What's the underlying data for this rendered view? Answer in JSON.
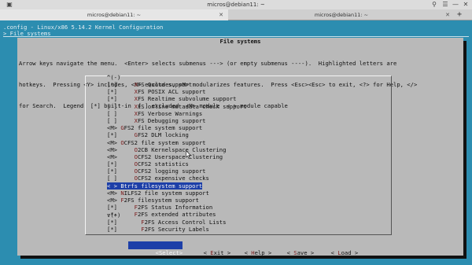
{
  "window": {
    "title": "micros@debian11: ~",
    "tabs": [
      {
        "label": "micros@debian11: ~",
        "active": true
      },
      {
        "label": "micros@debian11: ~",
        "active": false
      }
    ]
  },
  "terminal": {
    "config_line": ".config - Linux/x86 5.14.2 Kernel Configuration",
    "breadcrumb": "> File systems"
  },
  "dialog": {
    "title": "File systems",
    "help_lines": [
      "Arrow keys navigate the menu.  <Enter> selects submenus ---> (or empty submenus ----).  Highlighted letters are",
      "hotkeys.  Pressing <Y> includes, <N> excludes, <M> modularizes features.  Press <Esc><Esc> to exit, <?> for Help, </>",
      "for Search.  Legend: [*] built-in  [ ] excluded  <M> module  < > module capable"
    ],
    "scroll_up": "^(-)",
    "scroll_down": "v(+)",
    "items": [
      {
        "prefix": "[*]     ",
        "hotkey": "X",
        "rest": "FS Quota support",
        "selected": false
      },
      {
        "prefix": "[*]     ",
        "hotkey": "X",
        "rest": "FS POSIX ACL support",
        "selected": false
      },
      {
        "prefix": "[*]     ",
        "hotkey": "X",
        "rest": "FS Realtime subvolume support",
        "selected": false
      },
      {
        "prefix": "[ ]     ",
        "hotkey": "X",
        "rest": "FS online metadata check support",
        "selected": false
      },
      {
        "prefix": "[ ]     ",
        "hotkey": "X",
        "rest": "FS Verbose Warnings",
        "selected": false
      },
      {
        "prefix": "[ ]     ",
        "hotkey": "X",
        "rest": "FS Debugging support",
        "selected": false
      },
      {
        "prefix": "<M> ",
        "hotkey": "G",
        "rest": "FS2 file system support",
        "selected": false
      },
      {
        "prefix": "[*]     ",
        "hotkey": "G",
        "rest": "FS2 DLM locking",
        "selected": false
      },
      {
        "prefix": "<M> ",
        "hotkey": "O",
        "rest": "CFS2 file system support",
        "selected": false
      },
      {
        "prefix": "<M>     ",
        "hotkey": "O",
        "rest": "2CB Kernelspace Clustering",
        "selected": false
      },
      {
        "prefix": "<M>     ",
        "hotkey": "O",
        "rest": "CFS2 Userspace Clustering",
        "selected": false
      },
      {
        "prefix": "[*]     ",
        "hotkey": "O",
        "rest": "CFS2 statistics",
        "selected": false
      },
      {
        "prefix": "[*]     ",
        "hotkey": "O",
        "rest": "CFS2 logging support",
        "selected": false
      },
      {
        "prefix": "[ ]     ",
        "hotkey": "O",
        "rest": "CFS2 expensive checks",
        "selected": false
      },
      {
        "prefix": "< > ",
        "hotkey": "B",
        "rest": "trfs filesystem support",
        "selected": true
      },
      {
        "prefix": "<M> ",
        "hotkey": "N",
        "rest": "ILFS2 file system support",
        "selected": false
      },
      {
        "prefix": "<M> ",
        "hotkey": "F",
        "rest": "2FS filesystem support",
        "selected": false
      },
      {
        "prefix": "[*]     ",
        "hotkey": "F",
        "rest": "2FS Status Information",
        "selected": false
      },
      {
        "prefix": "-*-     ",
        "hotkey": "F",
        "rest": "2FS extended attributes",
        "selected": false
      },
      {
        "prefix": "[*]       ",
        "hotkey": "F",
        "rest": "2FS Access Control Lists",
        "selected": false
      },
      {
        "prefix": "[*]       ",
        "hotkey": "F",
        "rest": "2FS Security Labels",
        "selected": false
      }
    ],
    "buttons": [
      {
        "pre": "<",
        "hotkey": "S",
        "post": "elect>",
        "focused": true
      },
      {
        "pre": "< ",
        "hotkey": "E",
        "post": "xit >",
        "focused": false
      },
      {
        "pre": "< ",
        "hotkey": "H",
        "post": "elp >",
        "focused": false
      },
      {
        "pre": "< ",
        "hotkey": "S",
        "post": "ave >",
        "focused": false
      },
      {
        "pre": "< ",
        "hotkey": "L",
        "post": "oad >",
        "focused": false
      }
    ]
  },
  "colors": {
    "terminal_bg": "#2c8db0",
    "dialog_bg": "#b9b9b9",
    "selection_bg": "#1d3fa8",
    "hotkey": "#7a1a1a"
  }
}
